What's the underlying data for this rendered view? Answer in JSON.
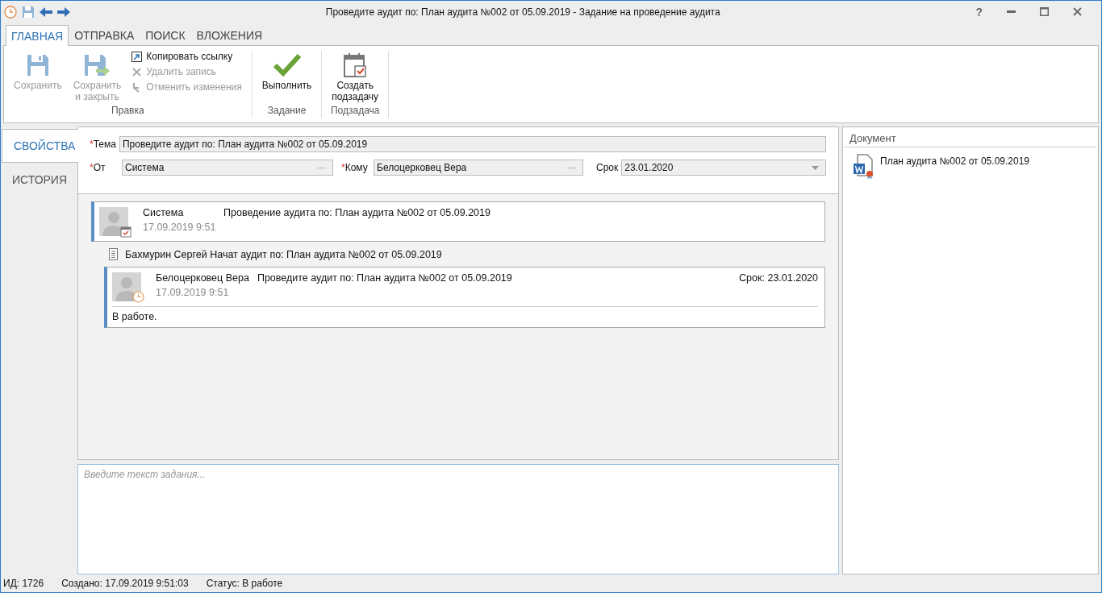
{
  "window": {
    "title": "Проведите аудит по: План аудита №002 от 05.09.2019 - Задание на проведение аудита",
    "help": "?"
  },
  "ribbon_tabs": [
    {
      "label": "ГЛАВНАЯ",
      "selected": true
    },
    {
      "label": "ОТПРАВКА",
      "selected": false
    },
    {
      "label": "ПОИСК",
      "selected": false
    },
    {
      "label": "ВЛОЖЕНИЯ",
      "selected": false
    }
  ],
  "ribbon_groups": [
    {
      "label": "Правка",
      "buttons": [
        {
          "kind": "save",
          "label": "Сохранить",
          "disabled": true
        },
        {
          "kind": "save-close",
          "label": "Сохранить\nи закрыть",
          "disabled": true
        },
        {
          "kind": "copy-link",
          "label": "Копировать ссылку",
          "disabled": false
        },
        {
          "kind": "delete",
          "label": "Удалить запись",
          "disabled": true
        },
        {
          "kind": "undo",
          "label": "Отменить изменения",
          "disabled": true
        }
      ]
    },
    {
      "label": "Задание",
      "buttons": [
        {
          "kind": "complete",
          "label": "Выполнить",
          "disabled": false
        }
      ]
    },
    {
      "label": "Подзадача",
      "buttons": [
        {
          "kind": "subtask",
          "label": "Создать\nподзадачу",
          "disabled": false
        }
      ]
    }
  ],
  "required_mark": "*",
  "side_tabs": [
    {
      "label": "СВОЙСТВА",
      "selected": true
    },
    {
      "label": "ИСТОРИЯ",
      "selected": false
    }
  ],
  "form_rows": [
    [
      {
        "kind": "text",
        "label": "Тема",
        "required": true,
        "value": "Проведите аудит по: План аудита №002 от 05.09.2019"
      }
    ],
    [
      {
        "kind": "lookup",
        "label": "От",
        "required": true,
        "value": "Система"
      },
      {
        "kind": "lookup",
        "label": "Кому",
        "required": true,
        "value": "Белоцерковец Вера"
      },
      {
        "kind": "date",
        "label": "Срок",
        "required": false,
        "value": "23.01.2020"
      }
    ]
  ],
  "feed": [
    {
      "kind": "created",
      "author": "Система",
      "subject": "Проведение аудита по: План аудита №002 от 05.09.2019",
      "time": "17.09.2019 9:51",
      "children": [
        {
          "kind": "event",
          "text": "Бахмурин Сергей Начат аудит по: План аудита №002 от 05.09.2019"
        },
        {
          "kind": "in_progress",
          "author": "Белоцерковец Вера",
          "subject": "Проведите аудит по: План аудита №002 от 05.09.2019",
          "time": "17.09.2019 9:51",
          "due": "Срок: 23.01.2020",
          "comment": "В работе."
        }
      ]
    }
  ],
  "editor": {
    "placeholder": "Введите текст задания..."
  },
  "document_panel": {
    "title": "Документ",
    "items": [
      {
        "name": "План аудита №002 от 05.09.2019"
      }
    ]
  },
  "status_bar": [
    "ИД: 1726",
    "Создано: 17.09.2019 9:51:03",
    "Статус: В работе"
  ]
}
